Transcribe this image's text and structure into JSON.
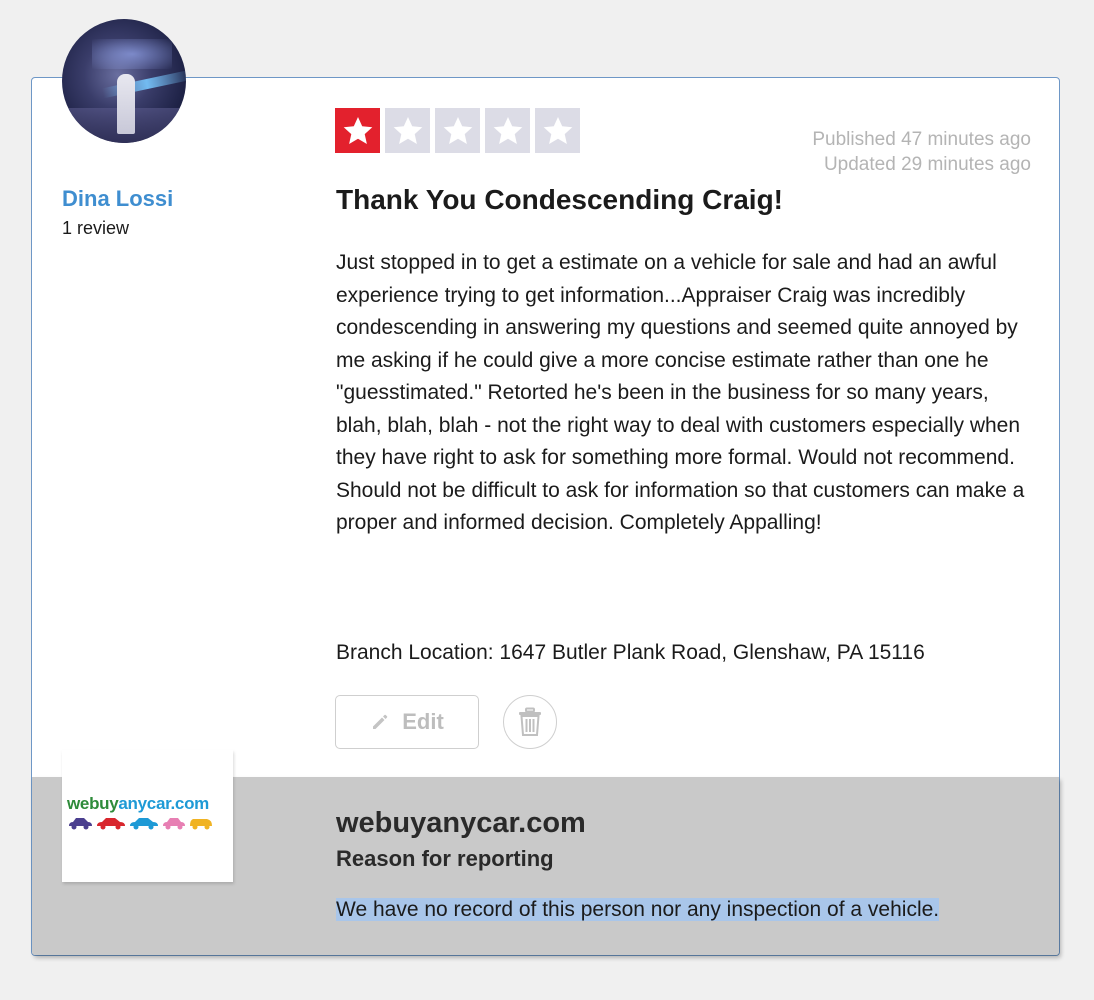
{
  "reviewer": {
    "name": "Dina Lossi",
    "review_count": "1 review"
  },
  "rating": {
    "value": 1,
    "max": 5,
    "active_color": "#e3212d",
    "inactive_color": "#dcdce6"
  },
  "dates": {
    "published": "Published 47 minutes ago",
    "updated": "Updated 29 minutes ago"
  },
  "review": {
    "title": "Thank You Condescending Craig!",
    "body": "Just stopped in to get a estimate on a vehicle for sale and had an awful experience trying to get information...Appraiser Craig was incredibly condescending in answering my questions and seemed quite annoyed by me asking if he could give a more concise estimate rather than one he \"guesstimated.\" Retorted he's been in the business for so many years, blah, blah, blah - not the right way to deal with customers especially when they have right to ask for something more formal. Would not recommend. Should not be difficult to ask for information so that customers can make a proper and informed decision. Completely Appalling!",
    "branch": "Branch Location: 1647 Butler Plank Road, Glenshaw, PA 15116"
  },
  "actions": {
    "edit_label": "Edit",
    "edit_icon": "pencil-icon",
    "delete_icon": "trash-icon"
  },
  "report": {
    "company_logo_text_part1": "webuy",
    "company_logo_text_part2": "anycar.com",
    "company_name": "webuyanycar.com",
    "reason_label": "Reason for reporting",
    "reason_text": "We have no record of this person nor any inspection of a vehicle.",
    "highlight_color": "#a9c6ea"
  },
  "colors": {
    "name_link": "#3f8ed0",
    "card_border": "#6e97c6",
    "report_bg": "#c9c9c9"
  }
}
